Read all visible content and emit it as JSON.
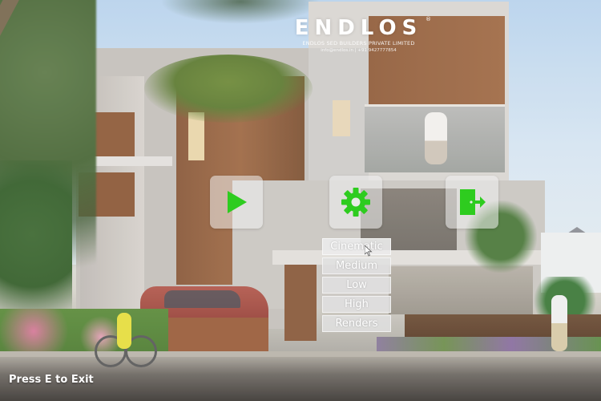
{
  "logo": {
    "brand": "ENDLOS",
    "registered": "®",
    "subtitle": "ENDLOS SED BUILDERS PRIVATE LIMITED",
    "contact": "info@endlos.in | +91 9427777854"
  },
  "menu": {
    "play_icon": "play-icon",
    "settings_icon": "gear-icon",
    "exit_icon": "exit-door-icon",
    "accent_color": "#2ecc1f"
  },
  "quality_options": [
    "Cinematic",
    "Medium",
    "Low",
    "High",
    "Renders"
  ],
  "hint": {
    "exit_text": "Press E to Exit"
  }
}
